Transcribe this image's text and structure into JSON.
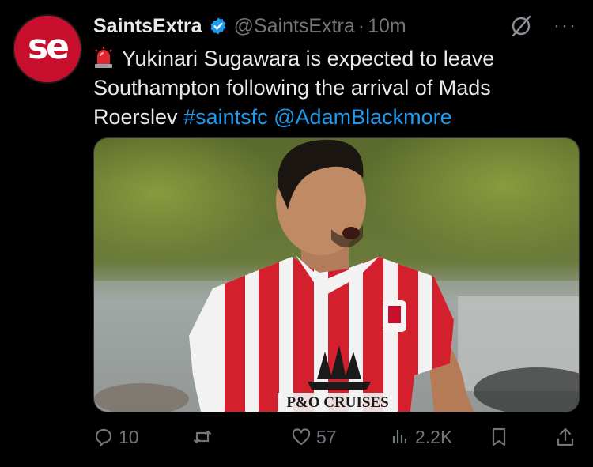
{
  "account": {
    "display_name": "SaintsExtra",
    "handle": "@SaintsExtra",
    "separator": "·",
    "time": "10m",
    "avatar_text": "se",
    "avatar_color": "#c8102e",
    "verified": true
  },
  "header_icons": [
    "grok-icon",
    "more-icon"
  ],
  "more_label": "···",
  "tweet": {
    "text": "Yukinari Sugawara is expected to leave Southampton following the arrival of Mads Roerslev",
    "hashtag": "#saintsfc",
    "mention": "@AdamBlackmore",
    "link_color": "#1d9bf0"
  },
  "media": {
    "shirt_sponsor": "P&O CRUISES"
  },
  "actions": {
    "replies": "10",
    "retweets": "",
    "likes": "57",
    "views": "2.2K"
  }
}
